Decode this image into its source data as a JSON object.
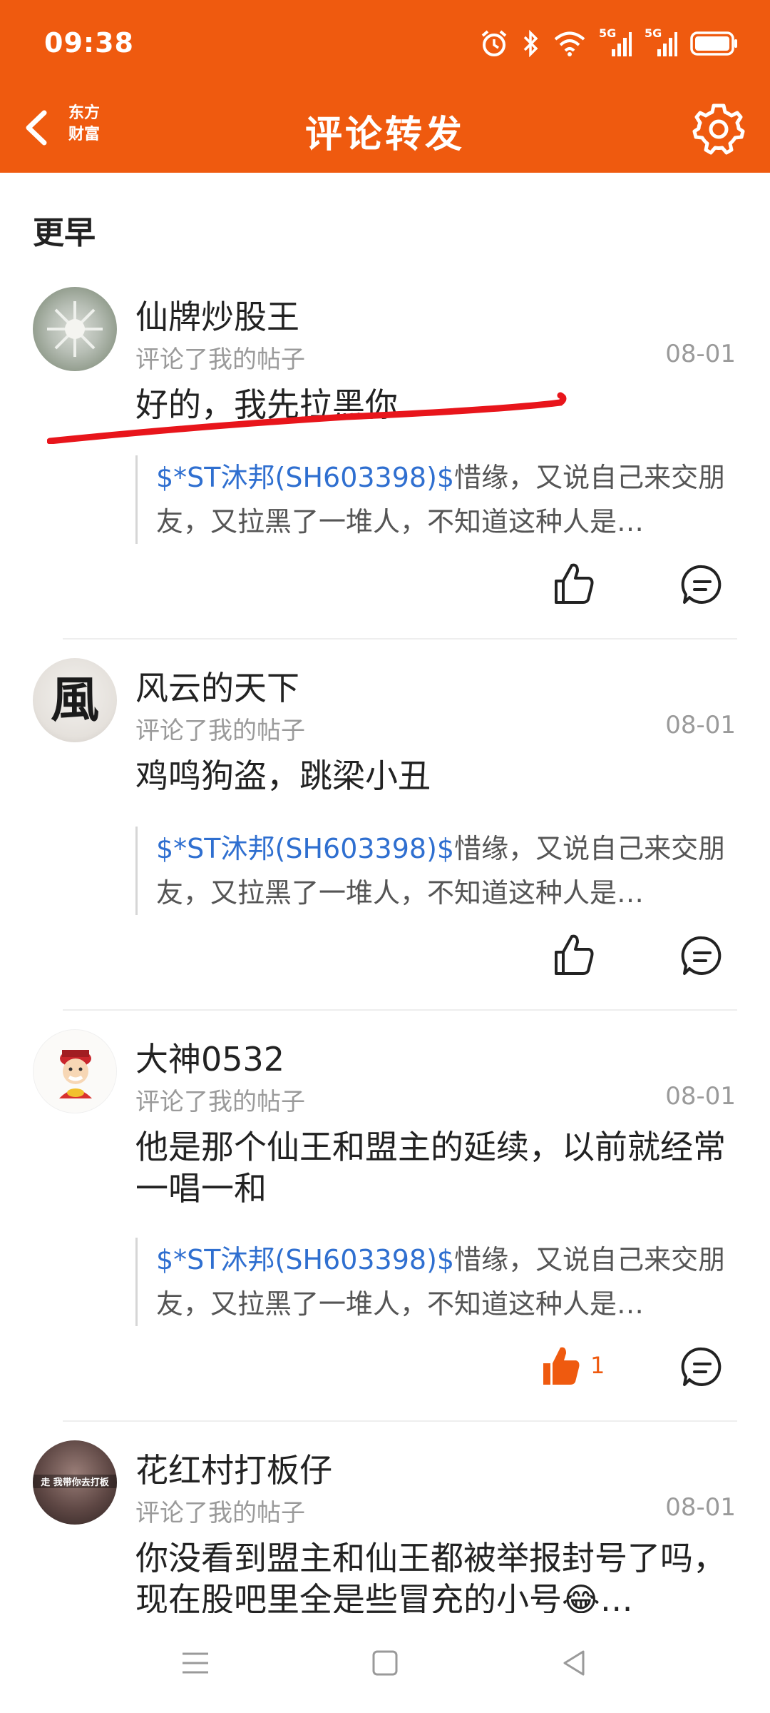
{
  "status_bar": {
    "time": "09:38",
    "network_1": "5G",
    "network_2": "5G",
    "icons": [
      "alarm-icon",
      "bluetooth-icon",
      "wifi-icon",
      "signal-icon",
      "signal-icon",
      "battery-icon"
    ]
  },
  "header": {
    "title": "评论转发",
    "logo_line1": "东方",
    "logo_line2": "财富",
    "back_icon": "chevron-left-icon",
    "settings_icon": "gear-icon"
  },
  "section": {
    "title": "更早"
  },
  "items": [
    {
      "name": "仙牌炒股王",
      "action": "评论了我的帖子",
      "date": "08-01",
      "comment": "好的，我先拉黑你",
      "quote_ref": "$*ST沐邦(SH603398)$",
      "quote_text": "惜缘，又说自己来交朋友，又拉黑了一堆人，不知道这种人是…",
      "like_count": ""
    },
    {
      "name": "风云的天下",
      "action": "评论了我的帖子",
      "date": "08-01",
      "comment": "鸡鸣狗盗，跳梁小丑",
      "quote_ref": "$*ST沐邦(SH603398)$",
      "quote_text": "惜缘，又说自己来交朋友，又拉黑了一堆人，不知道这种人是…",
      "avatar_char": "風",
      "like_count": ""
    },
    {
      "name": "大神0532",
      "action": "评论了我的帖子",
      "date": "08-01",
      "comment": "他是那个仙王和盟主的延续，以前就经常一唱一和",
      "quote_ref": "$*ST沐邦(SH603398)$",
      "quote_text": "惜缘，又说自己来交朋友，又拉黑了一堆人，不知道这种人是…",
      "like_count": "1",
      "liked": true
    },
    {
      "name": "花红村打板仔",
      "action": "评论了我的帖子",
      "date": "08-01",
      "comment": "你没看到盟主和仙王都被举报封号了吗，现在股吧里全是些冒充的小号😂…",
      "avatar_text": "走 我带你去打板"
    }
  ],
  "accent_color": "#ef5a0f",
  "link_color": "#2f6fd0",
  "annotation_color": "#e8151b",
  "navbar": {
    "icons": [
      "menu-icon",
      "home-square-icon",
      "back-triangle-icon"
    ]
  }
}
